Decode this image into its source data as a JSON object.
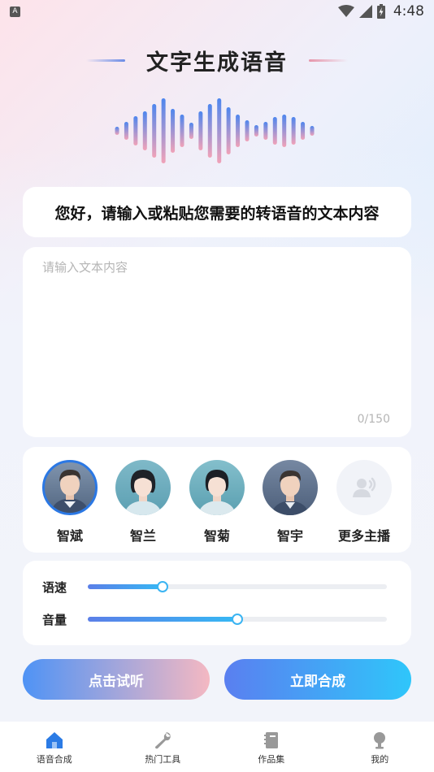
{
  "status_bar": {
    "notification_icon": "A",
    "time": "4:48",
    "icons": [
      "wifi-icon",
      "cellular-signal-icon",
      "battery-charging-icon"
    ]
  },
  "header": {
    "title": "文字生成语音"
  },
  "prompt": {
    "text": "您好，请输入或粘贴您需要的转语音的文本内容"
  },
  "text_input": {
    "value": "",
    "placeholder": "请输入文本内容",
    "counter": "0/150"
  },
  "voices": {
    "items": [
      {
        "name": "智斌",
        "selected": true,
        "avatar": "male"
      },
      {
        "name": "智兰",
        "selected": false,
        "avatar": "female"
      },
      {
        "name": "智菊",
        "selected": false,
        "avatar": "female"
      },
      {
        "name": "智宇",
        "selected": false,
        "avatar": "male"
      }
    ],
    "more_label": "更多主播",
    "more_icon": "voice-person-icon"
  },
  "sliders": {
    "speed": {
      "label": "语速",
      "value": 0.25
    },
    "volume": {
      "label": "音量",
      "value": 0.5
    }
  },
  "buttons": {
    "listen": "点击试听",
    "synthesize": "立即合成"
  },
  "bottom_nav": {
    "items": [
      {
        "label": "语音合成",
        "icon": "home-icon",
        "active": true
      },
      {
        "label": "热门工具",
        "icon": "wrench-icon",
        "active": false
      },
      {
        "label": "作品集",
        "icon": "notebook-icon",
        "active": false
      },
      {
        "label": "我的",
        "icon": "profile-icon",
        "active": false
      }
    ]
  },
  "colors": {
    "accent": "#2b78e4",
    "slider_thumb": "#3ab4f2",
    "nav_inactive": "#999999",
    "nav_active": "#2b7be5"
  }
}
